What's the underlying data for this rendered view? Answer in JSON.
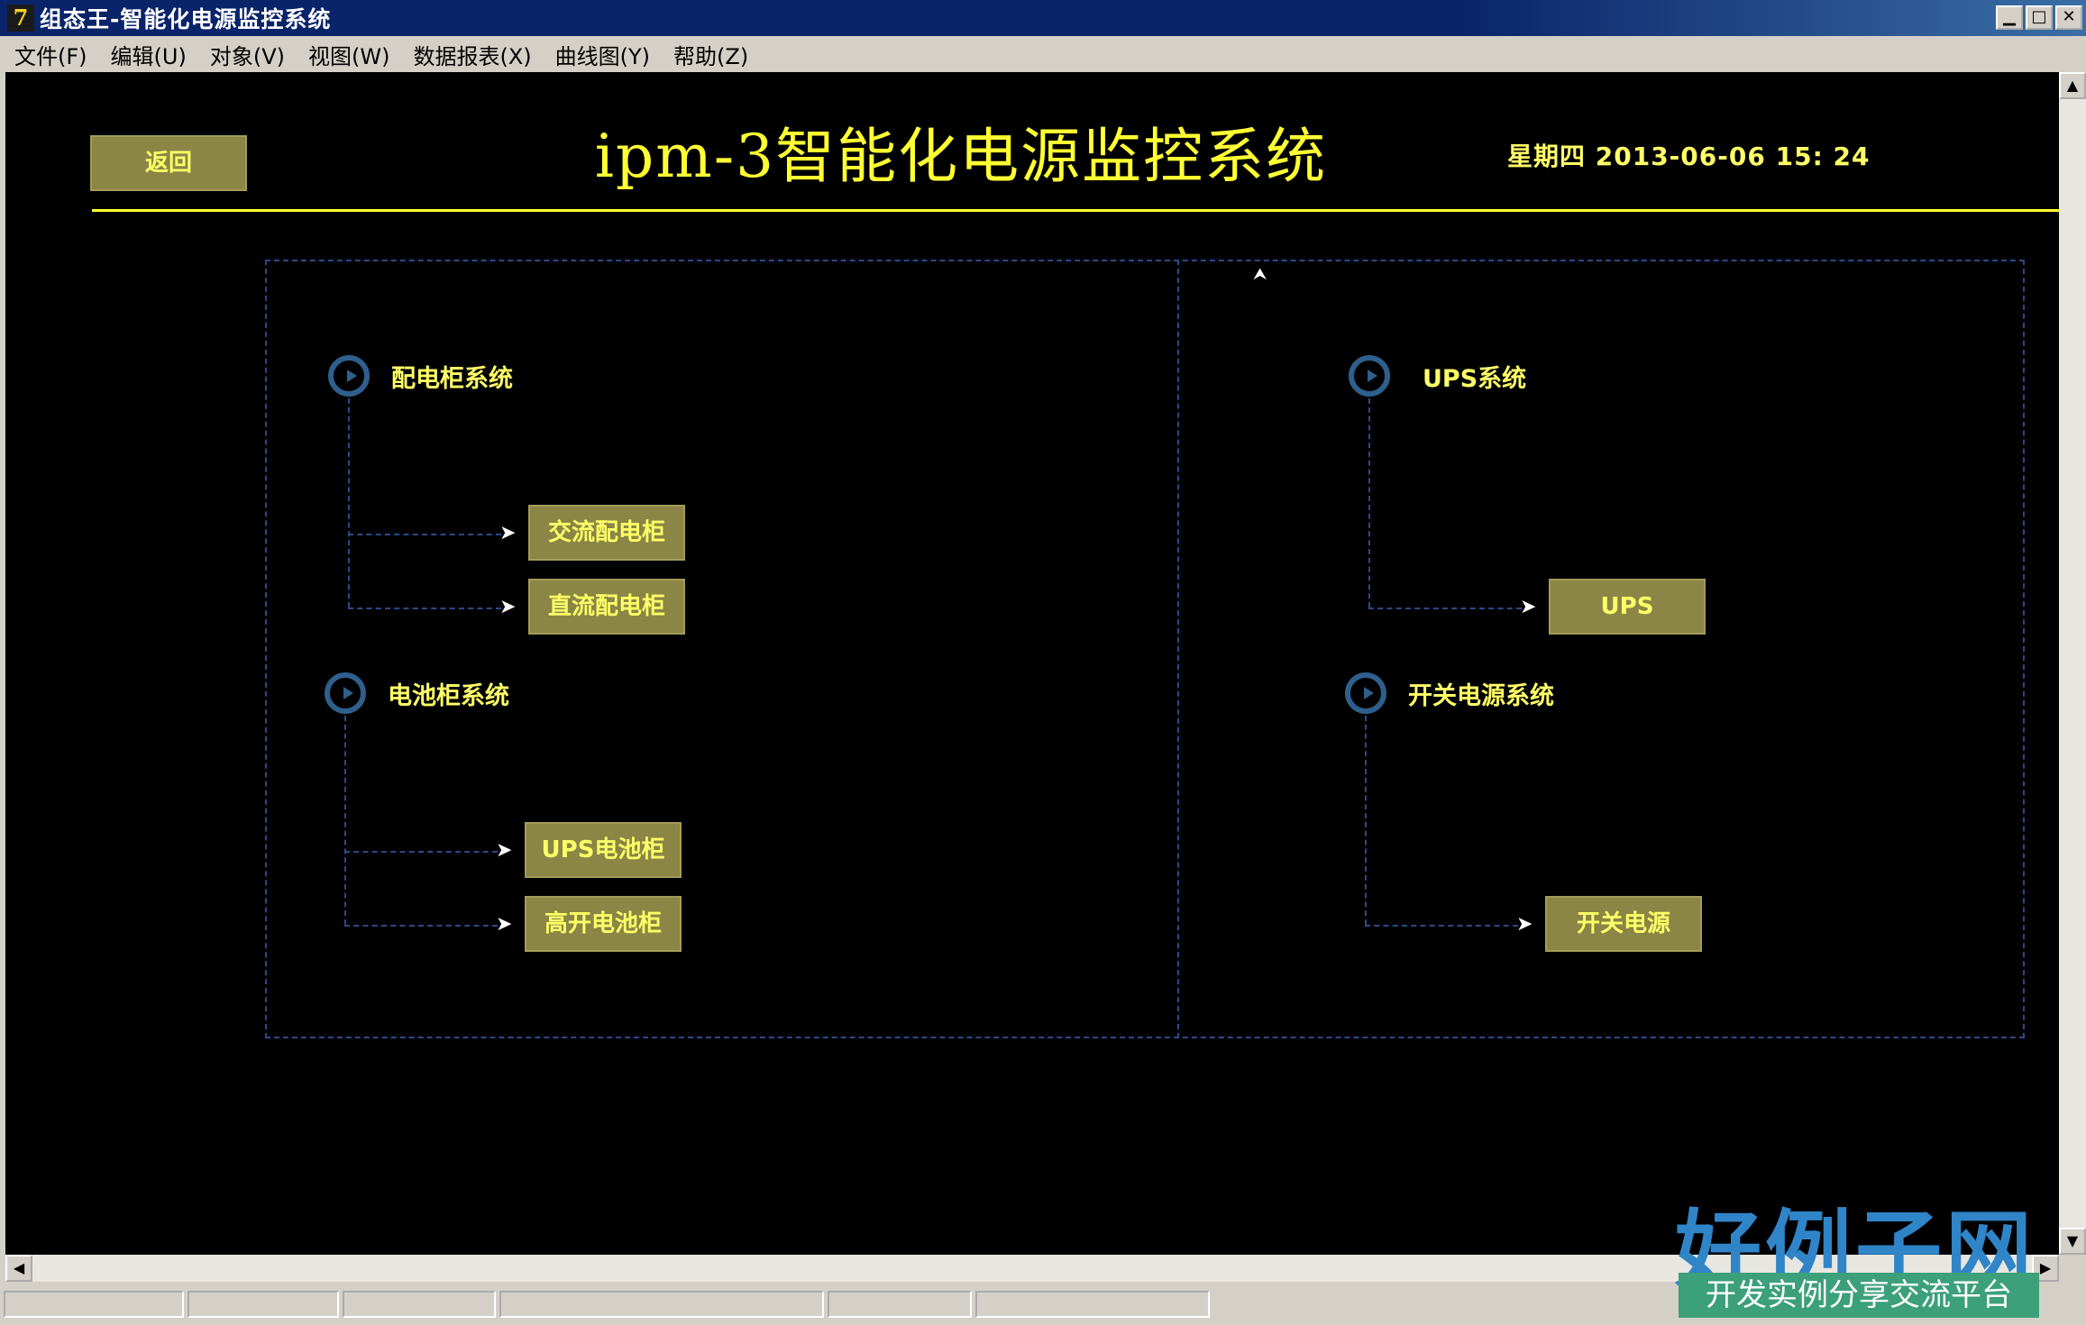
{
  "window": {
    "title": "组态王-智能化电源监控系统",
    "icon_text": "7",
    "controls": [
      "▁",
      "□",
      "✕"
    ]
  },
  "menu": {
    "items": [
      "文件(F)",
      "编辑(U)",
      "对象(V)",
      "视图(W)",
      "数据报表(X)",
      "曲线图(Y)",
      "帮助(Z)"
    ]
  },
  "header": {
    "back_label": "返回",
    "title": "ipm-3智能化电源监控系统",
    "datetime": "星期四 2013-06-06 15: 24"
  },
  "left_panel": {
    "group1": {
      "label": "配电柜系统",
      "items": [
        "交流配电柜",
        "直流配电柜"
      ]
    },
    "group2": {
      "label": "电池柜系统",
      "items": [
        "UPS电池柜",
        "高开电池柜"
      ]
    }
  },
  "right_panel": {
    "group1": {
      "label": "UPS系统",
      "items": [
        "UPS"
      ]
    },
    "group2": {
      "label": "开关电源系统",
      "items": [
        "开关电源"
      ]
    }
  },
  "watermark": {
    "title": "好例子网",
    "subtitle": "开发实例分享交流平台"
  },
  "colors": {
    "background": "#000000",
    "accent_yellow": "#ffff33",
    "button_bg": "#8b8546",
    "connector_blue": "#2a4a8a",
    "icon_blue": "#2e5f8d"
  }
}
